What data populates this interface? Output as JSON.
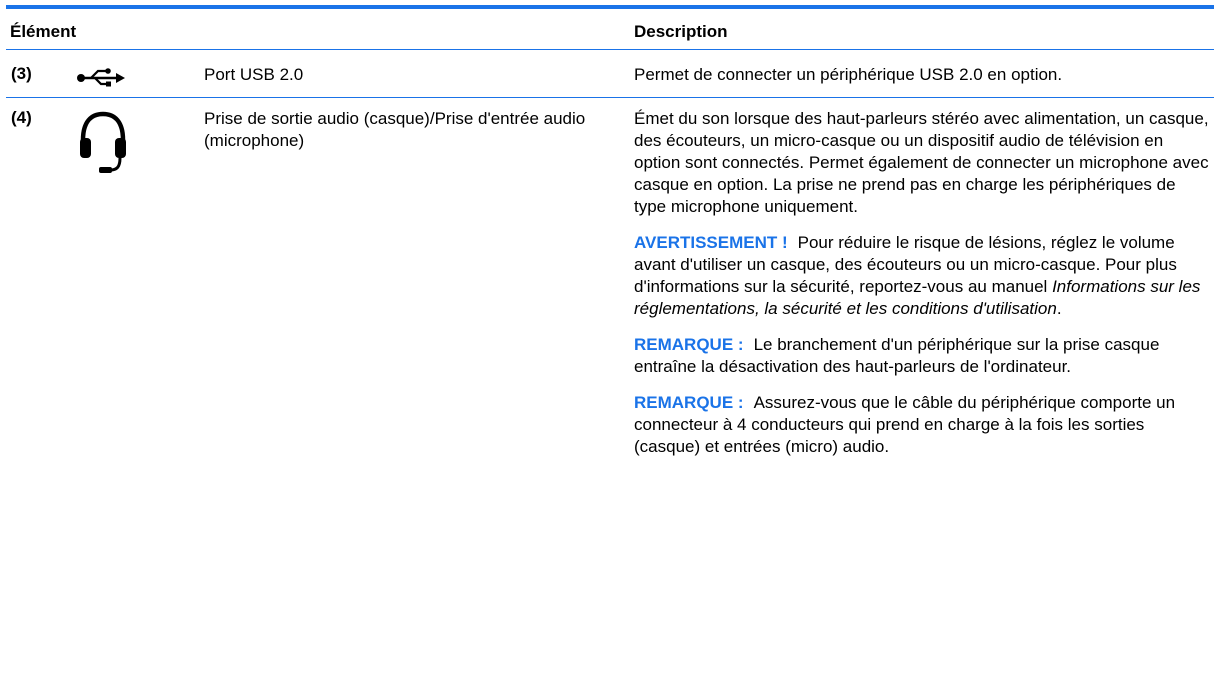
{
  "header": {
    "element_label": "Élément",
    "description_label": "Description"
  },
  "rows": [
    {
      "number": "(3)",
      "icon": "usb-icon",
      "name": "Port USB 2.0",
      "description": "Permet de connecter un périphérique USB 2.0 en option."
    },
    {
      "number": "(4)",
      "icon": "headphones-icon",
      "name": "Prise de sortie audio (casque)/Prise d'entrée audio (microphone)",
      "description": "Émet du son lorsque des haut-parleurs stéréo avec alimentation, un casque, des écouteurs, un micro-casque ou un dispositif audio de télévision en option sont connectés. Permet également de connecter un microphone avec casque en option. La prise ne prend pas en charge les périphériques de type microphone uniquement.",
      "warning": {
        "label": "AVERTISSEMENT !",
        "text_before": "Pour réduire le risque de lésions, réglez le volume avant d'utiliser un casque, des écouteurs ou un micro-casque. Pour plus d'informations sur la sécurité, reportez-vous au manuel ",
        "text_italic": "Informations sur les réglementations, la sécurité et les conditions d'utilisation",
        "text_after": "."
      },
      "notes": [
        {
          "label": "REMARQUE :",
          "text": "Le branchement d'un périphérique sur la prise casque entraîne la désactivation des haut-parleurs de l'ordinateur."
        },
        {
          "label": "REMARQUE :",
          "text": "Assurez-vous que le câble du périphérique comporte un connecteur à 4 conducteurs qui prend en charge à la fois les sorties (casque) et entrées (micro) audio."
        }
      ]
    }
  ],
  "colors": {
    "accent": "#1a73e8"
  }
}
